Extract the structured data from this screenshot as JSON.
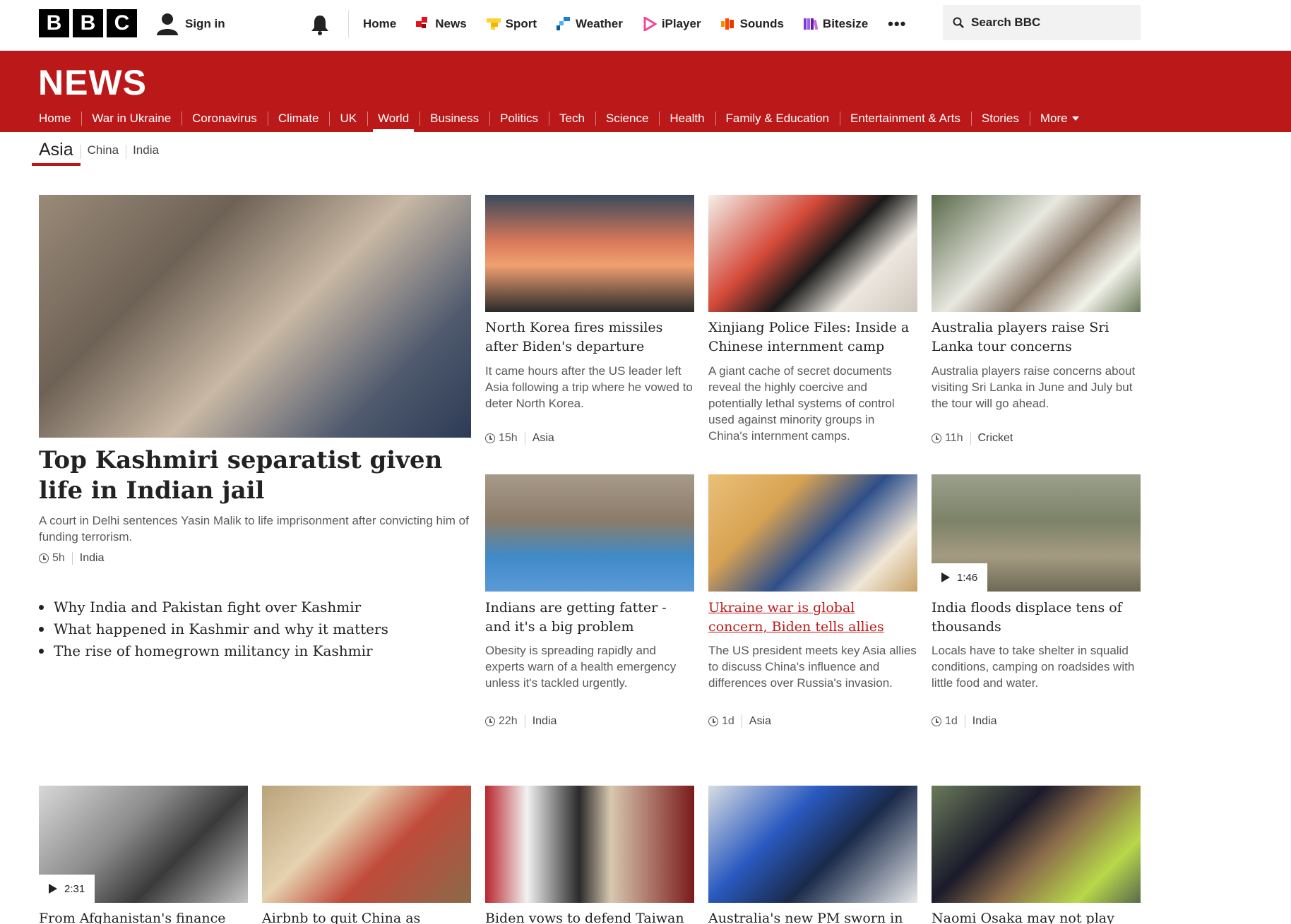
{
  "masthead": {
    "logo_letters": [
      "B",
      "B",
      "C"
    ],
    "sign_in": "Sign in",
    "nav": [
      {
        "label": "Home",
        "icon": "none"
      },
      {
        "label": "News",
        "icon": "news-icon",
        "color": "#e7101d"
      },
      {
        "label": "Sport",
        "icon": "sport-icon",
        "color": "#ffd230"
      },
      {
        "label": "Weather",
        "icon": "weather-icon",
        "color": "#1a7fd8"
      },
      {
        "label": "iPlayer",
        "icon": "iplayer-icon",
        "color": "#f54997"
      },
      {
        "label": "Sounds",
        "icon": "sounds-icon",
        "color": "#ff4900"
      },
      {
        "label": "Bitesize",
        "icon": "bitesize-icon",
        "color": "#7a3bd6"
      }
    ],
    "more": "•••",
    "search_placeholder": "Search BBC"
  },
  "news": {
    "wordmark": "NEWS",
    "nav": [
      "Home",
      "War in Ukraine",
      "Coronavirus",
      "Climate",
      "UK",
      "World",
      "Business",
      "Politics",
      "Tech",
      "Science",
      "Health",
      "Family & Education",
      "Entertainment & Arts",
      "Stories",
      "More"
    ],
    "active": "World"
  },
  "subnav": {
    "items": [
      "Asia",
      "China",
      "India"
    ],
    "active": "Asia"
  },
  "lead": {
    "headline": "Top Kashmiri separatist given life in Indian jail",
    "summary": "A court in Delhi sentences Yasin Malik to life imprisonment after convicting him of funding terrorism.",
    "time": "5h",
    "category": "India",
    "related": [
      "Why India and Pakistan fight over Kashmir",
      "What happened in Kashmir and why it matters",
      "The rise of homegrown militancy in Kashmir"
    ]
  },
  "cards": [
    {
      "headline": "North Korea fires missiles after Biden's departure",
      "summary": "It came hours after the US leader left Asia following a trip where he vowed to deter North Korea.",
      "time": "15h",
      "category": "Asia"
    },
    {
      "headline": "Xinjiang Police Files: Inside a Chinese internment camp",
      "summary": "A giant cache of secret documents reveal the highly coercive and potentially lethal systems of control used against minority groups in China's internment camps."
    },
    {
      "headline": "Australia players raise Sri Lanka tour concerns",
      "summary": "Australia players raise concerns about visiting Sri Lanka in June and July but the tour will go ahead.",
      "time": "11h",
      "category": "Cricket"
    },
    {
      "headline": "Indians are getting fatter - and it's a big problem",
      "summary": "Obesity is spreading rapidly and experts warn of a health emergency unless it's tackled urgently.",
      "time": "22h",
      "category": "India"
    },
    {
      "headline": "Ukraine war is global concern, Biden tells allies",
      "summary": "The US president meets key Asia allies to discuss China's influence and differences over Russia's invasion.",
      "time": "1d",
      "category": "Asia"
    },
    {
      "headline": "India floods displace tens of thousands",
      "summary": "Locals have to take shelter in squalid conditions, camping on roadsides with little food and water.",
      "time": "1d",
      "category": "India",
      "video": "1:46"
    }
  ],
  "bottom_cards": [
    {
      "headline": "From Afghanistan's finance",
      "video": "2:31"
    },
    {
      "headline": "Airbnb to quit China as"
    },
    {
      "headline": "Biden vows to defend Taiwan"
    },
    {
      "headline": "Australia's new PM sworn in"
    },
    {
      "headline": "Naomi Osaka may not play"
    }
  ]
}
